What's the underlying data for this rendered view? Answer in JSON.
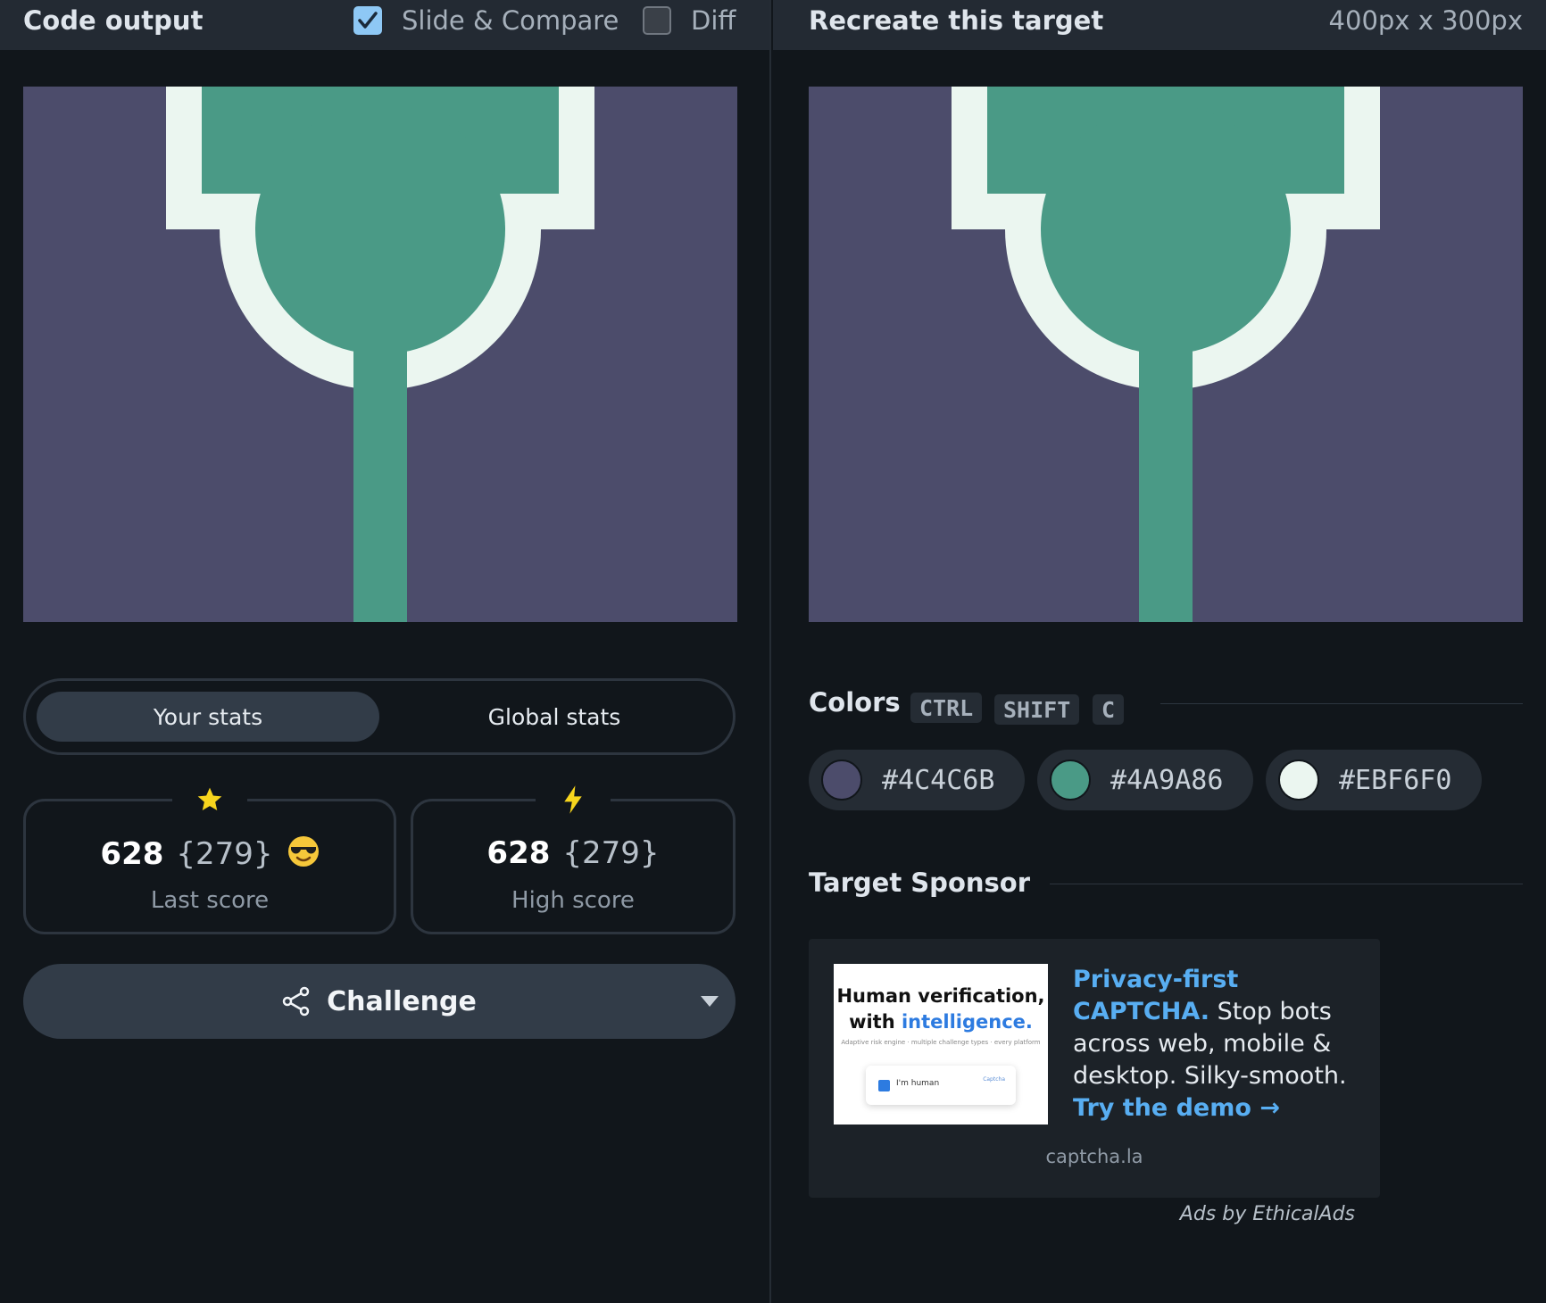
{
  "code_output": {
    "title": "Code output",
    "slide_compare": {
      "label": "Slide & Compare",
      "checked": true
    },
    "diff": {
      "label": "Diff",
      "checked": false
    }
  },
  "target": {
    "title": "Recreate this target",
    "dimensions": "400px x 300px"
  },
  "stats": {
    "tabs": [
      "Your stats",
      "Global stats"
    ],
    "active_tab": "Your stats",
    "last": {
      "score": "628",
      "match": "{279}",
      "label": "Last score",
      "icon": "star-icon"
    },
    "high": {
      "score": "628",
      "match": "{279}",
      "label": "High score",
      "icon": "lightning-icon"
    }
  },
  "challenge": {
    "label": "Challenge",
    "icon": "share-icon"
  },
  "colors": {
    "title": "Colors",
    "shortcut": [
      "CTRL",
      "SHIFT",
      "C"
    ],
    "swatches": [
      {
        "hex": "#4C4C6B",
        "color": "#4C4C6B"
      },
      {
        "hex": "#4A9A86",
        "color": "#4A9A86"
      },
      {
        "hex": "#EBF6F0",
        "color": "#EBF6F0"
      }
    ]
  },
  "sponsor": {
    "title": "Target Sponsor",
    "image": {
      "heading_line1": "Human verification,",
      "heading_line2_prefix": "with ",
      "heading_line2_highlight": "intelligence.",
      "tagline": "Adaptive risk engine · multiple challenge types · every platform",
      "checkbox_label": "I'm human",
      "brand": "Captcha"
    },
    "headline": "Privacy-first CAPTCHA.",
    "body": " Stop bots across web, mobile & desktop. Silky-smooth.",
    "cta": "Try the demo →",
    "domain": "captcha.la",
    "ads_by": "Ads by EthicalAds"
  },
  "palette": {
    "bg": "#4C4C6B",
    "green": "#4A9A86",
    "light": "#EBF6F0",
    "accent": "#58AEF2"
  }
}
